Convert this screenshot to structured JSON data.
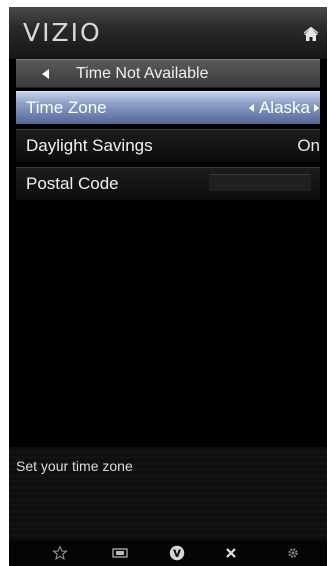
{
  "header": {
    "logo": "VIZIO",
    "home_icon": "home-icon"
  },
  "back_bar": {
    "title": "Time Not Available",
    "back_icon": "back-arrow-icon"
  },
  "menu": {
    "items": [
      {
        "label": "Time Zone",
        "value": "Alaska",
        "selected": true
      },
      {
        "label": "Daylight Savings",
        "value": "On",
        "selected": false
      },
      {
        "label": "Postal Code",
        "value": "",
        "selected": false
      }
    ]
  },
  "help": {
    "text": "Set your time zone"
  },
  "bottom_bar": {
    "icons": [
      "star-icon",
      "widescreen-icon",
      "vizio-v-icon",
      "close-x-icon",
      "gear-icon"
    ]
  },
  "colors": {
    "selected_row": "#8ea2c8",
    "background": "#000000",
    "text": "#f2f2f2"
  }
}
